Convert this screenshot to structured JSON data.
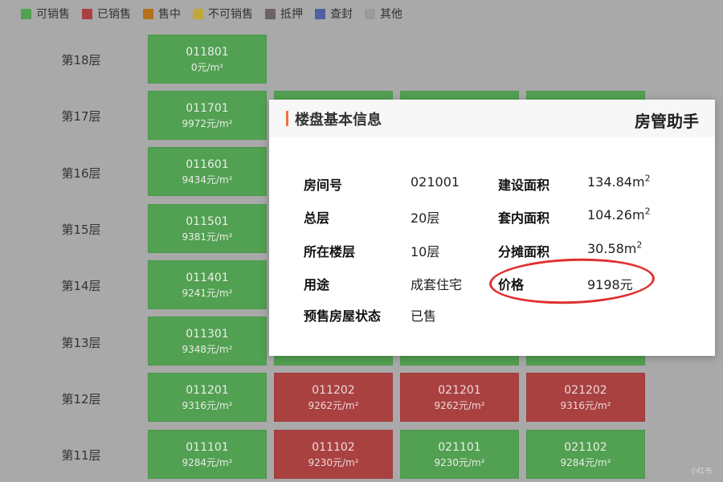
{
  "legend": [
    {
      "label": "可销售",
      "color": "#52a052"
    },
    {
      "label": "已销售",
      "color": "#a94141"
    },
    {
      "label": "售中",
      "color": "#b5701a"
    },
    {
      "label": "不可销售",
      "color": "#c0a93a"
    },
    {
      "label": "抵押",
      "color": "#6f6266"
    },
    {
      "label": "查封",
      "color": "#5060a0"
    },
    {
      "label": "其他",
      "color": "#9a9a9a"
    }
  ],
  "floors": [
    {
      "label": "第18层"
    },
    {
      "label": "第17层"
    },
    {
      "label": "第16层"
    },
    {
      "label": "第15层"
    },
    {
      "label": "第14层"
    },
    {
      "label": "第13层"
    },
    {
      "label": "第12层"
    },
    {
      "label": "第11层"
    }
  ],
  "units": {
    "f18": [
      {
        "no": "011801",
        "price": "0元/m²",
        "status": "green"
      }
    ],
    "f17": [
      {
        "no": "011701",
        "price": "9972元/m²",
        "status": "green"
      }
    ],
    "f16": [
      {
        "no": "011601",
        "price": "9434元/m²",
        "status": "green"
      }
    ],
    "f15": [
      {
        "no": "011501",
        "price": "9381元/m²",
        "status": "green"
      }
    ],
    "f14": [
      {
        "no": "011401",
        "price": "9241元/m²",
        "status": "green"
      }
    ],
    "f13": [
      {
        "no": "011301",
        "price": "9348元/m²",
        "status": "green"
      }
    ],
    "f12": [
      {
        "no": "011201",
        "price": "9316元/m²",
        "status": "green"
      },
      {
        "no": "011202",
        "price": "9262元/m²",
        "status": "red"
      },
      {
        "no": "021201",
        "price": "9262元/m²",
        "status": "red"
      },
      {
        "no": "021202",
        "price": "9316元/m²",
        "status": "red"
      }
    ],
    "f11": [
      {
        "no": "011101",
        "price": "9284元/m²",
        "status": "green"
      },
      {
        "no": "011102",
        "price": "9230元/m²",
        "status": "red"
      },
      {
        "no": "021101",
        "price": "9230元/m²",
        "status": "green"
      },
      {
        "no": "021102",
        "price": "9284元/m²",
        "status": "green"
      }
    ]
  },
  "modal": {
    "title": "楼盘基本信息",
    "brand": "房管助手",
    "fields": {
      "room_no": {
        "label": "房间号",
        "value": "021001"
      },
      "total_floors": {
        "label": "总层",
        "value": "20层"
      },
      "floor": {
        "label": "所在楼层",
        "value": "10层"
      },
      "usage": {
        "label": "用途",
        "value": "成套住宅"
      },
      "status": {
        "label": "预售房屋状态",
        "value": "已售"
      },
      "build_area": {
        "label": "建设面积",
        "value": "134.84m",
        "unit_sup": "2"
      },
      "inner_area": {
        "label": "套内面积",
        "value": "104.26m",
        "unit_sup": "2"
      },
      "shared_area": {
        "label": "分摊面积",
        "value": "30.58m",
        "unit_sup": "2"
      },
      "price": {
        "label": "价格",
        "value": "9198元"
      }
    }
  },
  "watermark": "小红书"
}
